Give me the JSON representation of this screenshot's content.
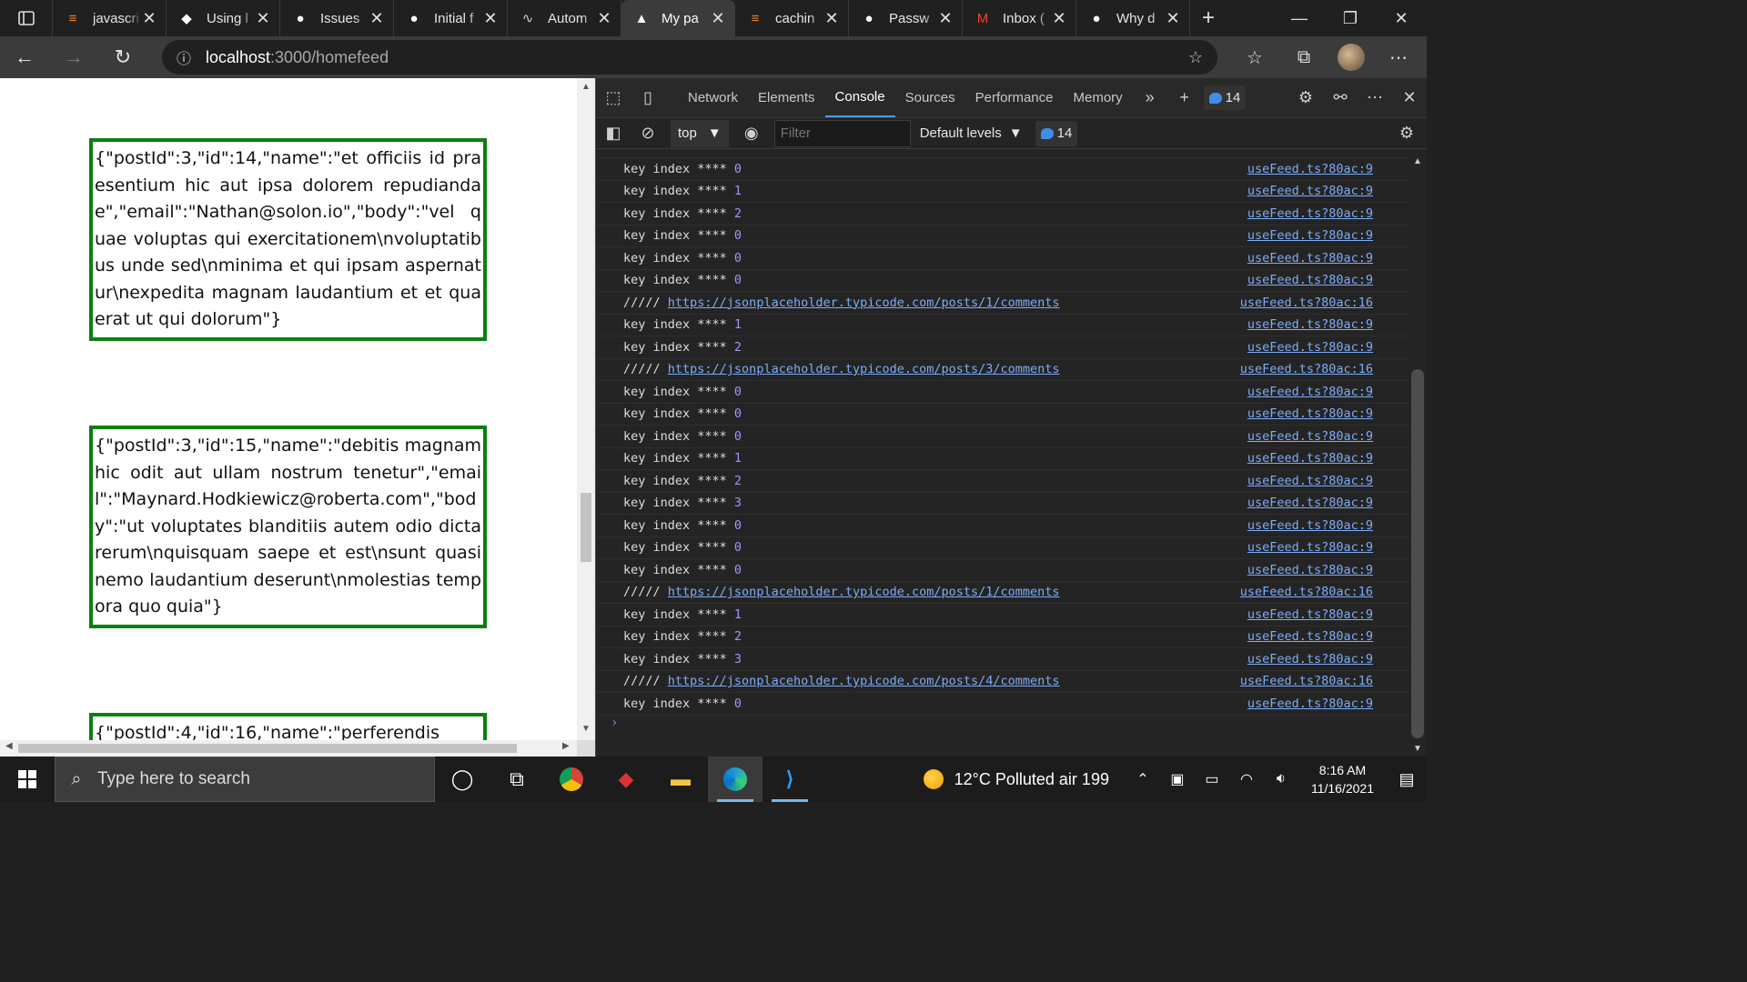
{
  "browser": {
    "tabs": [
      {
        "title": "javascri",
        "icon": "stackoverflow-icon",
        "active": false
      },
      {
        "title": "Using l",
        "icon": "react-query-icon",
        "active": false
      },
      {
        "title": "Issues",
        "icon": "github-icon",
        "active": false
      },
      {
        "title": "Initial f",
        "icon": "github-icon",
        "active": false
      },
      {
        "title": "Autom",
        "icon": "wave-icon",
        "active": false
      },
      {
        "title": "My pa",
        "icon": "nextjs-icon",
        "active": true
      },
      {
        "title": "cachin",
        "icon": "stackoverflow-icon",
        "active": false
      },
      {
        "title": "Passw",
        "icon": "github-icon",
        "active": false
      },
      {
        "title": "Inbox (",
        "icon": "gmail-icon",
        "active": false
      },
      {
        "title": "Why d",
        "icon": "github-icon",
        "active": false
      }
    ],
    "url_host": "localhost",
    "url_rest": ":3000/homefeed"
  },
  "page": {
    "cards": [
      "{\"postId\":3,\"id\":14,\"name\":\"et officiis id praesentium hic aut ipsa dolorem repudiandae\",\"email\":\"Nathan@solon.io\",\"body\":\"vel quae voluptas qui exercitationem\\nvoluptatibus unde sed\\nminima et qui ipsam aspernatur\\nexpedita magnam laudantium et et quaerat ut qui dolorum\"}",
      "{\"postId\":3,\"id\":15,\"name\":\"debitis magnam hic odit aut ullam nostrum tenetur\",\"email\":\"Maynard.Hodkiewicz@roberta.com\",\"body\":\"ut voluptates blanditiis autem odio dicta rerum\\nquisquam saepe et est\\nsunt quasi nemo laudantium deserunt\\nmolestias tempora quo quia\"}",
      "{\"postId\":4,\"id\":16,\"name\":\"perferendis"
    ]
  },
  "devtools": {
    "tabs": [
      "Network",
      "Elements",
      "Console",
      "Sources",
      "Performance",
      "Memory"
    ],
    "active_tab": "Console",
    "issues_count": "14",
    "context": "top",
    "filter_placeholder": "Filter",
    "levels": "Default levels",
    "message_count": "14",
    "log": [
      {
        "kind": "key",
        "text": "key index **** ",
        "value": "0",
        "source": "useFeed.ts?80ac:9"
      },
      {
        "kind": "key",
        "text": "key index **** ",
        "value": "1",
        "source": "useFeed.ts?80ac:9"
      },
      {
        "kind": "key",
        "text": "key index **** ",
        "value": "2",
        "source": "useFeed.ts?80ac:9"
      },
      {
        "kind": "key",
        "text": "key index **** ",
        "value": "0",
        "source": "useFeed.ts?80ac:9"
      },
      {
        "kind": "key",
        "text": "key index **** ",
        "value": "0",
        "source": "useFeed.ts?80ac:9"
      },
      {
        "kind": "key",
        "text": "key index **** ",
        "value": "0",
        "source": "useFeed.ts?80ac:9"
      },
      {
        "kind": "url",
        "text": "///// ",
        "value": "https://jsonplaceholder.typicode.com/posts/1/comments",
        "source": "useFeed.ts?80ac:16"
      },
      {
        "kind": "key",
        "text": "key index **** ",
        "value": "1",
        "source": "useFeed.ts?80ac:9"
      },
      {
        "kind": "key",
        "text": "key index **** ",
        "value": "2",
        "source": "useFeed.ts?80ac:9"
      },
      {
        "kind": "url",
        "text": "///// ",
        "value": "https://jsonplaceholder.typicode.com/posts/3/comments",
        "source": "useFeed.ts?80ac:16"
      },
      {
        "kind": "key",
        "text": "key index **** ",
        "value": "0",
        "source": "useFeed.ts?80ac:9"
      },
      {
        "kind": "key",
        "text": "key index **** ",
        "value": "0",
        "source": "useFeed.ts?80ac:9"
      },
      {
        "kind": "key",
        "text": "key index **** ",
        "value": "0",
        "source": "useFeed.ts?80ac:9"
      },
      {
        "kind": "key",
        "text": "key index **** ",
        "value": "1",
        "source": "useFeed.ts?80ac:9"
      },
      {
        "kind": "key",
        "text": "key index **** ",
        "value": "2",
        "source": "useFeed.ts?80ac:9"
      },
      {
        "kind": "key",
        "text": "key index **** ",
        "value": "3",
        "source": "useFeed.ts?80ac:9"
      },
      {
        "kind": "key",
        "text": "key index **** ",
        "value": "0",
        "source": "useFeed.ts?80ac:9"
      },
      {
        "kind": "key",
        "text": "key index **** ",
        "value": "0",
        "source": "useFeed.ts?80ac:9"
      },
      {
        "kind": "key",
        "text": "key index **** ",
        "value": "0",
        "source": "useFeed.ts?80ac:9"
      },
      {
        "kind": "url",
        "text": "///// ",
        "value": "https://jsonplaceholder.typicode.com/posts/1/comments",
        "source": "useFeed.ts?80ac:16"
      },
      {
        "kind": "key",
        "text": "key index **** ",
        "value": "1",
        "source": "useFeed.ts?80ac:9"
      },
      {
        "kind": "key",
        "text": "key index **** ",
        "value": "2",
        "source": "useFeed.ts?80ac:9"
      },
      {
        "kind": "key",
        "text": "key index **** ",
        "value": "3",
        "source": "useFeed.ts?80ac:9"
      },
      {
        "kind": "url",
        "text": "///// ",
        "value": "https://jsonplaceholder.typicode.com/posts/4/comments",
        "source": "useFeed.ts?80ac:16"
      },
      {
        "kind": "key",
        "text": "key index **** ",
        "value": "0",
        "source": "useFeed.ts?80ac:9"
      }
    ]
  },
  "taskbar": {
    "search_placeholder": "Type here to search",
    "weather": "12°C  Polluted air 199",
    "time": "8:16 AM",
    "date": "11/16/2021"
  },
  "colors": {
    "card_border": "#0c800c",
    "link": "#7cacf8",
    "number": "#a891f5",
    "accent": "#4a9df0"
  }
}
